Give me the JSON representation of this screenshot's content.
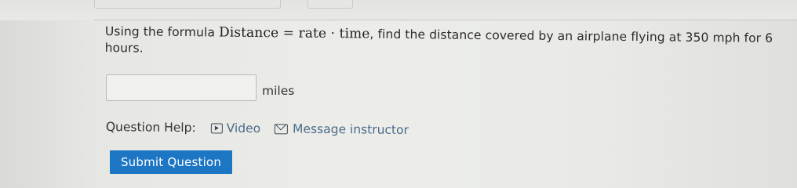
{
  "question": {
    "prefix": "Using the formula ",
    "formula_left": "Distance",
    "formula_equals": " = ",
    "formula_rate": "rate",
    "formula_dot": " · ",
    "formula_time": "time",
    "suffix": ", find the distance covered by an airplane flying at 350 mph for 6 hours."
  },
  "answer": {
    "value": "",
    "placeholder": "",
    "unit": "miles"
  },
  "help": {
    "label": "Question Help:",
    "video_icon": "video-play-icon",
    "video_label": "Video",
    "message_icon": "mail-icon",
    "message_label": "Message instructor"
  },
  "submit": {
    "label": "Submit Question",
    "color": "#1c76c4"
  }
}
